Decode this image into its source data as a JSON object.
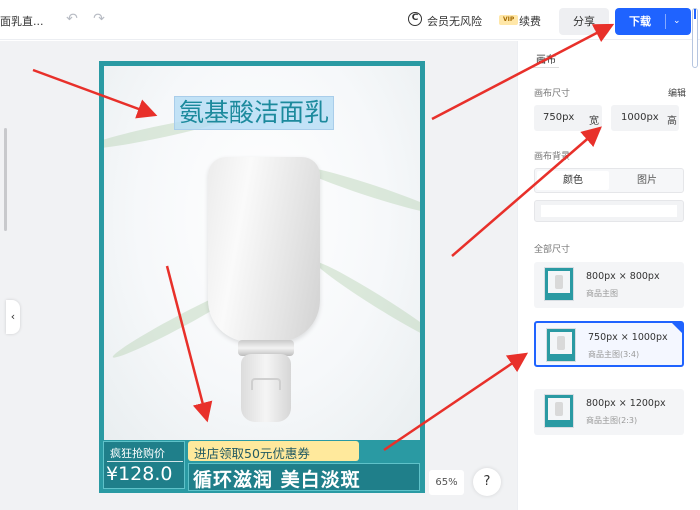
{
  "header": {
    "doc_title": "面乳直...",
    "undo_icon": "undo-icon",
    "redo_icon": "redo-icon",
    "member_text": "会员无风险",
    "vip_badge": "VIP",
    "renew_text": "续费",
    "share_label": "分享",
    "download_label": "下载"
  },
  "poster": {
    "headline": "氨基酸洁面乳",
    "promo_label": "疯狂抢购价",
    "price": "¥128.0",
    "coupon_text": "进店领取50元优惠券",
    "slogan": "循环滋润 美白淡斑"
  },
  "canvas_controls": {
    "zoom": "65%",
    "help": "?"
  },
  "panel": {
    "tab_label": "画布",
    "size_section": "画布尺寸",
    "edit_label": "编辑",
    "width_value": "750px",
    "width_unit": "宽",
    "height_value": "1000px",
    "height_unit": "高",
    "background_section": "画布背景",
    "bg_tabs": [
      "颜色",
      "图片"
    ],
    "all_sizes_section": "全部尺寸",
    "size_cards": [
      {
        "size": "800px × 800px",
        "sub": "商品主图",
        "selected": false
      },
      {
        "size": "750px × 1000px",
        "sub": "商品主图(3:4)",
        "selected": true
      },
      {
        "size": "800px × 1200px",
        "sub": "商品主图(2:3)",
        "selected": false
      }
    ]
  },
  "colors": {
    "accent": "#1f63ff",
    "teal": "#2a9aa3",
    "arrow": "#e8302a"
  }
}
